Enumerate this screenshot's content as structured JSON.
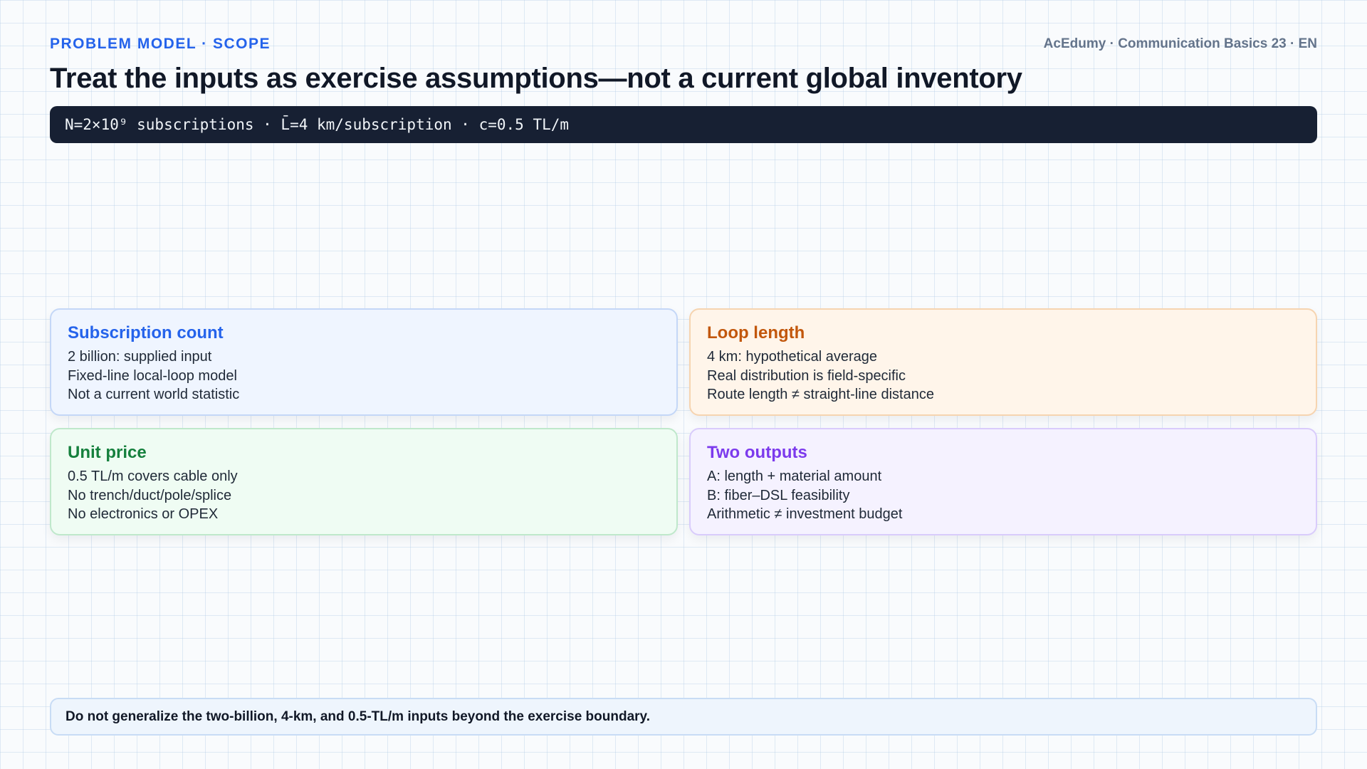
{
  "header": {
    "eyebrow": "PROBLEM MODEL · SCOPE",
    "course": "AcEdumy · Communication Basics 23 · EN",
    "title": "Treat the inputs as exercise assumptions—not a current global inventory"
  },
  "formula": "N=2×10⁹ subscriptions · L̄=4 km/subscription · c=0.5 TL/m",
  "cards": [
    {
      "title": "Subscription count",
      "color": "#2563eb",
      "lines": [
        "2 billion: supplied input",
        "Fixed-line local-loop model",
        "Not a current world statistic"
      ]
    },
    {
      "title": "Loop length",
      "color": "#c2570c",
      "lines": [
        "4 km: hypothetical average",
        "Real distribution is field-specific",
        "Route length ≠ straight-line distance"
      ]
    },
    {
      "title": "Unit price",
      "color": "#15803d",
      "lines": [
        "0.5 TL/m covers cable only",
        "No trench/duct/pole/splice",
        "No electronics or OPEX"
      ]
    },
    {
      "title": "Two outputs",
      "color": "#7c3aed",
      "lines": [
        "A: length + material amount",
        "B: fiber–DSL feasibility",
        "Arithmetic ≠ investment budget"
      ]
    }
  ],
  "note": "Do not generalize the two-billion, 4-km, and 0.5-TL/m inputs beyond the exercise boundary."
}
